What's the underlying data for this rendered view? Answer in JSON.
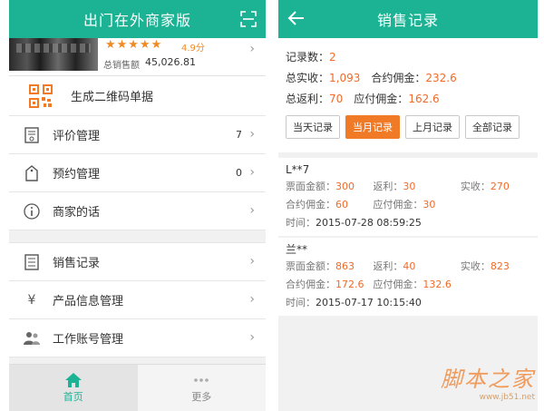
{
  "left": {
    "title": "出门在外商家版",
    "shop": {
      "stars": "★★★★★",
      "rating": "4.9分",
      "sales_label": "总销售额",
      "sales_value": "45,026.81"
    },
    "qr_item": {
      "label": "生成二维码单据"
    },
    "menu_group1": [
      {
        "label": "评价管理",
        "badge": "7"
      },
      {
        "label": "预约管理",
        "badge": "0"
      },
      {
        "label": "商家的话",
        "badge": ""
      }
    ],
    "menu_group2": [
      {
        "label": "销售记录"
      },
      {
        "label": "产品信息管理"
      },
      {
        "label": "工作账号管理"
      }
    ],
    "tabs": [
      {
        "label": "首页",
        "active": true
      },
      {
        "label": "更多",
        "active": false
      }
    ]
  },
  "right": {
    "title": "销售记录",
    "summary": {
      "count_label": "记录数：",
      "count_value": "2",
      "total_label": "总实收：",
      "total_value": "1,093",
      "commission_label": "合约佣金：",
      "commission_value": "232.6",
      "rebate_label": "总返利：",
      "rebate_value": "70",
      "payable_label": "应付佣金：",
      "payable_value": "162.6"
    },
    "filters": [
      {
        "label": "当天记录",
        "active": false
      },
      {
        "label": "当月记录",
        "active": true
      },
      {
        "label": "上月记录",
        "active": false
      },
      {
        "label": "全部记录",
        "active": false
      }
    ],
    "records": [
      {
        "name": "L**7",
        "ticket_label": "票面金额：",
        "ticket_value": "300",
        "rebate_label": "返利：",
        "rebate_value": "30",
        "received_label": "实收：",
        "received_value": "270",
        "commission_label": "合约佣金：",
        "commission_value": "60",
        "payable_label": "应付佣金：",
        "payable_value": "30",
        "time_label": "时间：",
        "time_value": "2015-07-28 08:59:25"
      },
      {
        "name": "兰**",
        "ticket_label": "票面金额：",
        "ticket_value": "863",
        "rebate_label": "返利：",
        "rebate_value": "40",
        "received_label": "实收：",
        "received_value": "823",
        "commission_label": "合约佣金：",
        "commission_value": "172.6",
        "payable_label": "应付佣金：",
        "payable_value": "132.6",
        "time_label": "时间：",
        "time_value": "2015-07-17 10:15:40"
      }
    ]
  },
  "watermark": {
    "main": "脚本之家",
    "url": "www.jb51.net"
  },
  "colors": {
    "brand": "#1bb394",
    "accent": "#f07a25",
    "value": "#f06b2a"
  },
  "icons": {
    "left_header": "scan-icon",
    "right_header": "back-arrow-icon",
    "qr": "qr-code-icon",
    "menu_group1": [
      "review-icon",
      "booking-icon",
      "info-icon"
    ],
    "menu_group2": [
      "list-icon",
      "yen-icon",
      "users-icon"
    ],
    "tabs": [
      "home-icon",
      "more-icon"
    ]
  }
}
